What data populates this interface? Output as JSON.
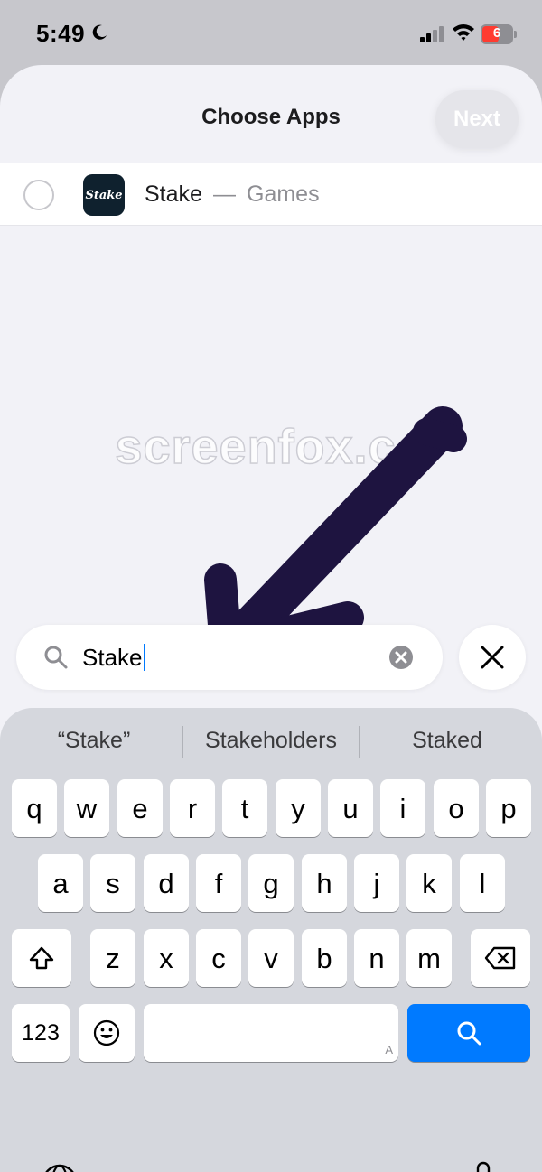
{
  "status_bar": {
    "time": "5:49",
    "battery_level": "6",
    "icons": [
      "moon-icon",
      "cellular-signal-icon",
      "wifi-icon",
      "battery-icon"
    ],
    "battery_color": "#ff3b30"
  },
  "sheet": {
    "title": "Choose Apps",
    "next_label": "Next"
  },
  "results": [
    {
      "name": "Stake",
      "separator": "—",
      "category": "Games",
      "icon_text": "Stake",
      "selected": false
    }
  ],
  "watermark": "screenfox.co",
  "search": {
    "value": "Stake",
    "icons": [
      "search-icon",
      "clear-icon",
      "close-icon"
    ]
  },
  "keyboard": {
    "suggestions": [
      "“Stake”",
      "Stakeholders",
      "Staked"
    ],
    "row1": [
      "q",
      "w",
      "e",
      "r",
      "t",
      "y",
      "u",
      "i",
      "o",
      "p"
    ],
    "row2": [
      "a",
      "s",
      "d",
      "f",
      "g",
      "h",
      "j",
      "k",
      "l"
    ],
    "row3": [
      "z",
      "x",
      "c",
      "v",
      "b",
      "n",
      "m"
    ],
    "numbers_label": "123",
    "space_hint": "A",
    "accent_color": "#007aff",
    "icons": [
      "shift-icon",
      "delete-icon",
      "emoji-icon",
      "search-icon",
      "globe-icon",
      "microphone-icon"
    ]
  },
  "annotation": {
    "type": "hand-drawn-arrow",
    "color": "#1e1440"
  }
}
